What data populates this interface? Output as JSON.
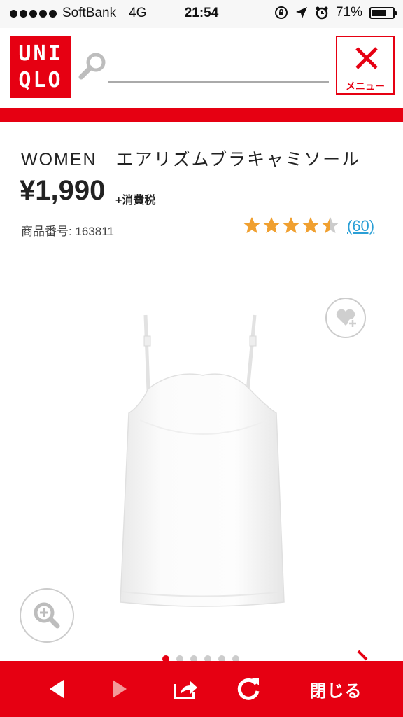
{
  "status_bar": {
    "carrier": "SoftBank",
    "network": "4G",
    "time": "21:54",
    "battery_percent": "71%",
    "battery_level": 0.71,
    "icons": [
      "orientation-lock-icon",
      "location-arrow-icon",
      "alarm-icon",
      "battery-icon"
    ]
  },
  "header": {
    "logo_lines": [
      "UNI",
      "QLO"
    ],
    "search": {
      "placeholder": "",
      "icon": "search-icon"
    },
    "menu_label": "メニュー",
    "menu_icon": "close-icon",
    "brand_color": "#e60012"
  },
  "product": {
    "title": "WOMEN　エアリズムブラキャミソール",
    "price": "¥1,990",
    "tax_note": "+消費税",
    "sku": "商品番号: 163811",
    "rating": 4.5,
    "rating_max": 5,
    "review_count": "(60)",
    "star_color": "#f0a030",
    "link_color": "#2a9fd6"
  },
  "gallery": {
    "image_icon": "camisole-image",
    "favorite_icon": "heart-plus-icon",
    "zoom_icon": "zoom-in-icon",
    "page_count": 6,
    "active_page": 1
  },
  "bottom_bar": {
    "back_icon": "back-arrow-icon",
    "forward_icon": "forward-arrow-icon",
    "share_icon": "share-icon",
    "reload_icon": "reload-icon",
    "close_label": "閉じる"
  }
}
